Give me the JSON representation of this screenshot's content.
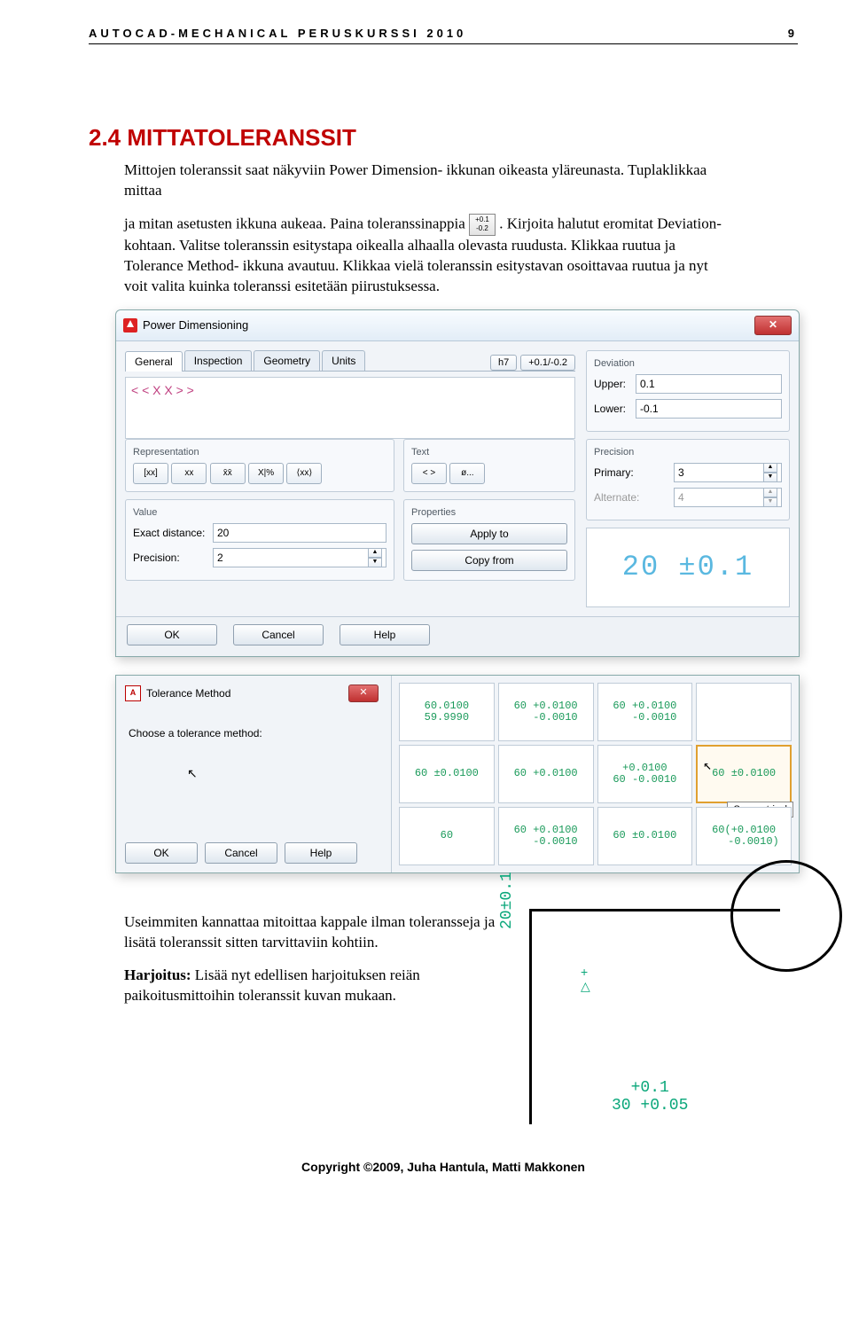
{
  "header": {
    "title": "AUTOCAD-MECHANICAL PERUSKURSSI 2010",
    "page": "9"
  },
  "section": {
    "heading": "2.4 MITTATOLERANSSIT",
    "para1": "Mittojen toleranssit saat näkyviin Power Dimension- ikkunan oikeasta yläreunasta. Tuplaklikkaa mittaa",
    "para2_prefix": "ja mitan asetusten ikkuna aukeaa. Paina toleranssinappia ",
    "para2_suffix": ". Kirjoita halutut eromitat Deviation-kohtaan. Valitse toleranssin esitystapa oikealla alhaalla olevasta ruudusta. Klikkaa ruutua ja Tolerance Method- ikkuna avautuu. Klikkaa vielä toleranssin esitystavan osoittavaa ruutua ja nyt voit valita kuinka toleranssi esitetään piirustuksessa.",
    "tolicon_top": "+0.1",
    "tolicon_bot": "-0.2"
  },
  "pd": {
    "title": "Power Dimensioning",
    "tabs": [
      "General",
      "Inspection",
      "Geometry",
      "Units"
    ],
    "h7": "h7",
    "expression": "< < X X > >",
    "group_rep": "Representation",
    "rep_buttons": [
      "[xx]",
      "xx",
      "x̄x̄",
      "X|%",
      "⟨xx⟩"
    ],
    "group_text": "Text",
    "text_buttons": [
      "< >",
      "ø..."
    ],
    "group_value": "Value",
    "exact_label": "Exact distance:",
    "exact_value": "20",
    "precision_label": "Precision:",
    "precision_value": "2",
    "group_props": "Properties",
    "apply": "Apply to",
    "copy": "Copy from",
    "group_dev": "Deviation",
    "upper_label": "Upper:",
    "upper_value": "0.1",
    "lower_label": "Lower:",
    "lower_value": "-0.1",
    "group_prec": "Precision",
    "primary_label": "Primary:",
    "primary_value": "3",
    "alt_label": "Alternate:",
    "alt_value": "4",
    "preview": "20 ±0.1",
    "ok": "OK",
    "cancel": "Cancel",
    "help": "Help"
  },
  "tm": {
    "title": "Tolerance Method",
    "prompt": "Choose a tolerance method:",
    "ok": "OK",
    "cancel": "Cancel",
    "help": "Help",
    "tooltip": "Symmetrical",
    "cells": [
      "60.0100\n59.9990",
      "60 +0.0100\n   -0.0010",
      "60 +0.0100\n   -0.0010",
      "60 ±0.0100",
      "60 +0.0100",
      "+0.0100\n60 -0.0010",
      "60 ±0.0100",
      "60",
      "60 +0.0100\n   -0.0010",
      "60 ±0.0100",
      "60(+0.0100\n   -0.0010)"
    ]
  },
  "bottom": {
    "p1": "Useimmiten kannattaa mitoittaa kappale ilman toleransseja ja lisätä toleranssit sitten tarvittaviin kohtiin.",
    "p2_bold": "Harjoitus:",
    "p2": " Lisää nyt edellisen harjoituksen reiän paikoitusmittoihin toleranssit kuvan mukaan."
  },
  "cad": {
    "dim_v": "20±0.1",
    "dim_h1": "+0.1",
    "dim_h2": "30 +0.05"
  },
  "footer": "Copyright ©2009, Juha Hantula, Matti Makkonen"
}
